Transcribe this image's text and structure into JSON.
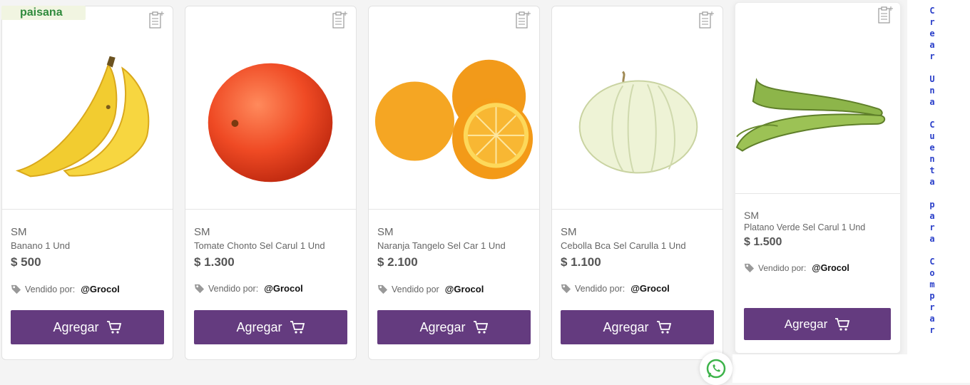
{
  "logo": {
    "text": "paisana"
  },
  "products": [
    {
      "brand": "SM",
      "name": "Banano 1 Und",
      "price": "$ 500",
      "sold_by_label": "Vendido por:",
      "seller": "@Grocol",
      "button_label": "Agregar",
      "image": "banana"
    },
    {
      "brand": "SM",
      "name": "Tomate Chonto Sel Carul 1 Und",
      "price": "$ 1.300",
      "sold_by_label": "Vendido por:",
      "seller": "@Grocol",
      "button_label": "Agregar",
      "image": "tomato"
    },
    {
      "brand": "SM",
      "name": "Naranja Tangelo Sel Car 1 Und",
      "price": "$ 2.100",
      "sold_by_label": "Vendido por",
      "seller": "@Grocol",
      "button_label": "Agregar",
      "image": "orange"
    },
    {
      "brand": "SM",
      "name": "Cebolla Bca Sel Carulla 1 Und",
      "price": "$ 1.100",
      "sold_by_label": "Vendido por:",
      "seller": "@Grocol",
      "button_label": "Agregar",
      "image": "onion"
    },
    {
      "brand": "SM",
      "name": "Platano Verde Sel Carul 1 Und",
      "price": "$ 1.500",
      "sold_by_label": "Vendido por:",
      "seller": "@Grocol",
      "button_label": "Agregar",
      "image": "plantain"
    }
  ],
  "side_link": {
    "text": "Crear Una Cuenta para Comprar"
  },
  "colors": {
    "button": "#643b7f",
    "link": "#2a3fc9",
    "logo": "#2f8a3c"
  }
}
